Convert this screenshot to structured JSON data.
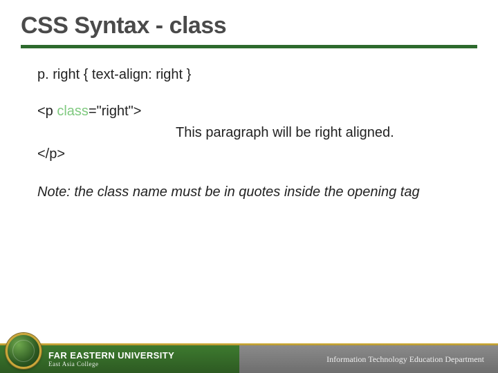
{
  "slide": {
    "title": "CSS Syntax - class",
    "css_rule": "p. right { text-align: right }",
    "code_open_pre": "<p ",
    "code_open_keyword": "class",
    "code_open_post": "=\"right\">",
    "code_body": "This paragraph will be right aligned.",
    "code_close": "</p>",
    "note": "Note: the class name must be in quotes inside the opening tag"
  },
  "footer": {
    "university": "FAR EASTERN UNIVERSITY",
    "college": "East Asia College",
    "department": "Information Technology Education Department"
  }
}
